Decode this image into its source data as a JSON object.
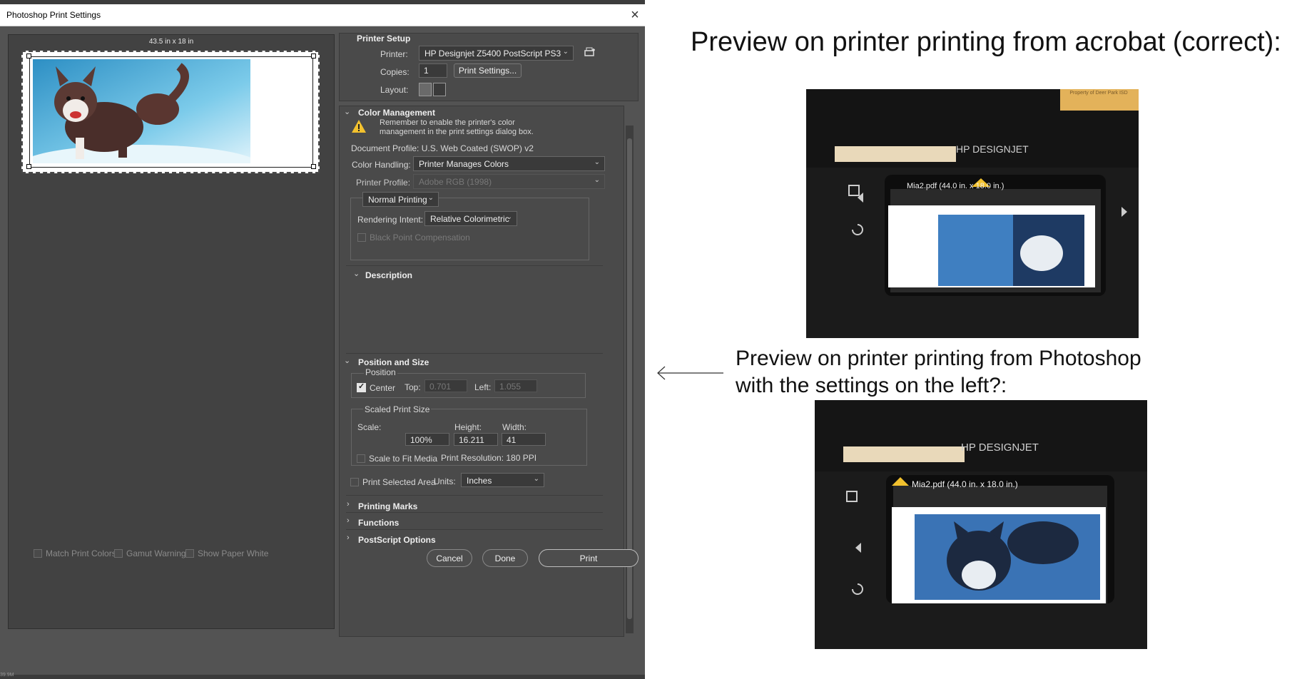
{
  "dialog": {
    "title": "Photoshop Print Settings",
    "close_label": "×",
    "paper_size": "43.5 in x 18 in",
    "footer_checks": [
      "Match Print Colors",
      "Gamut Warning",
      "Show Paper White"
    ],
    "buttons": {
      "cancel": "Cancel",
      "done": "Done",
      "print": "Print"
    },
    "status_text": "39.9M"
  },
  "printer_setup": {
    "title": "Printer Setup",
    "printer_label": "Printer:",
    "printer_value": "HP Designjet Z5400 PostScript PS3",
    "copies_label": "Copies:",
    "copies_value": "1",
    "print_settings_button": "Print Settings...",
    "layout_label": "Layout:"
  },
  "color_management": {
    "title": "Color Management",
    "warning": "Remember to enable the printer's color management in the print settings dialog box.",
    "document_profile": "Document Profile: U.S. Web Coated (SWOP) v2",
    "color_handling_label": "Color Handling:",
    "color_handling_value": "Printer Manages Colors",
    "printer_profile_label": "Printer Profile:",
    "printer_profile_value": "Adobe RGB (1998)",
    "print_mode": "Normal Printing",
    "rendering_intent_label": "Rendering Intent:",
    "rendering_intent_value": "Relative Colorimetric",
    "black_point": "Black Point Compensation"
  },
  "description": {
    "title": "Description"
  },
  "position_size": {
    "title": "Position and Size",
    "position_group": "Position",
    "center_label": "Center",
    "top_label": "Top:",
    "top_value": "0.701",
    "left_label": "Left:",
    "left_value": "1.055",
    "scaled_group": "Scaled Print Size",
    "scale_label": "Scale:",
    "height_label": "Height:",
    "width_label": "Width:",
    "scale_value": "100%",
    "height_value": "16.211",
    "width_value": "41",
    "scale_to_fit": "Scale to Fit Media",
    "print_resolution": "Print Resolution: 180 PPI",
    "print_selected_area": "Print Selected Area",
    "units_label": "Units:",
    "units_value": "Inches"
  },
  "collapsed_sections": [
    "Printing Marks",
    "Functions",
    "PostScript Options"
  ],
  "annotation": {
    "heading_top": "Preview on printer printing from acrobat (correct):",
    "heading_mid_line1": "Preview on printer printing from Photoshop",
    "heading_mid_line2": "with the settings on the left?:",
    "printer_brand": "HP DESIGNJET",
    "sticker": "Property of Deer Park ISD",
    "file_label": "Mia2.pdf (44.0 in. x 18.0 in.)"
  },
  "colors": {
    "dialog_bg": "#535353",
    "panel_bg": "#4a4a4a",
    "warning_yellow": "#f2c12e",
    "sky_blue": "#5fb7dc"
  }
}
